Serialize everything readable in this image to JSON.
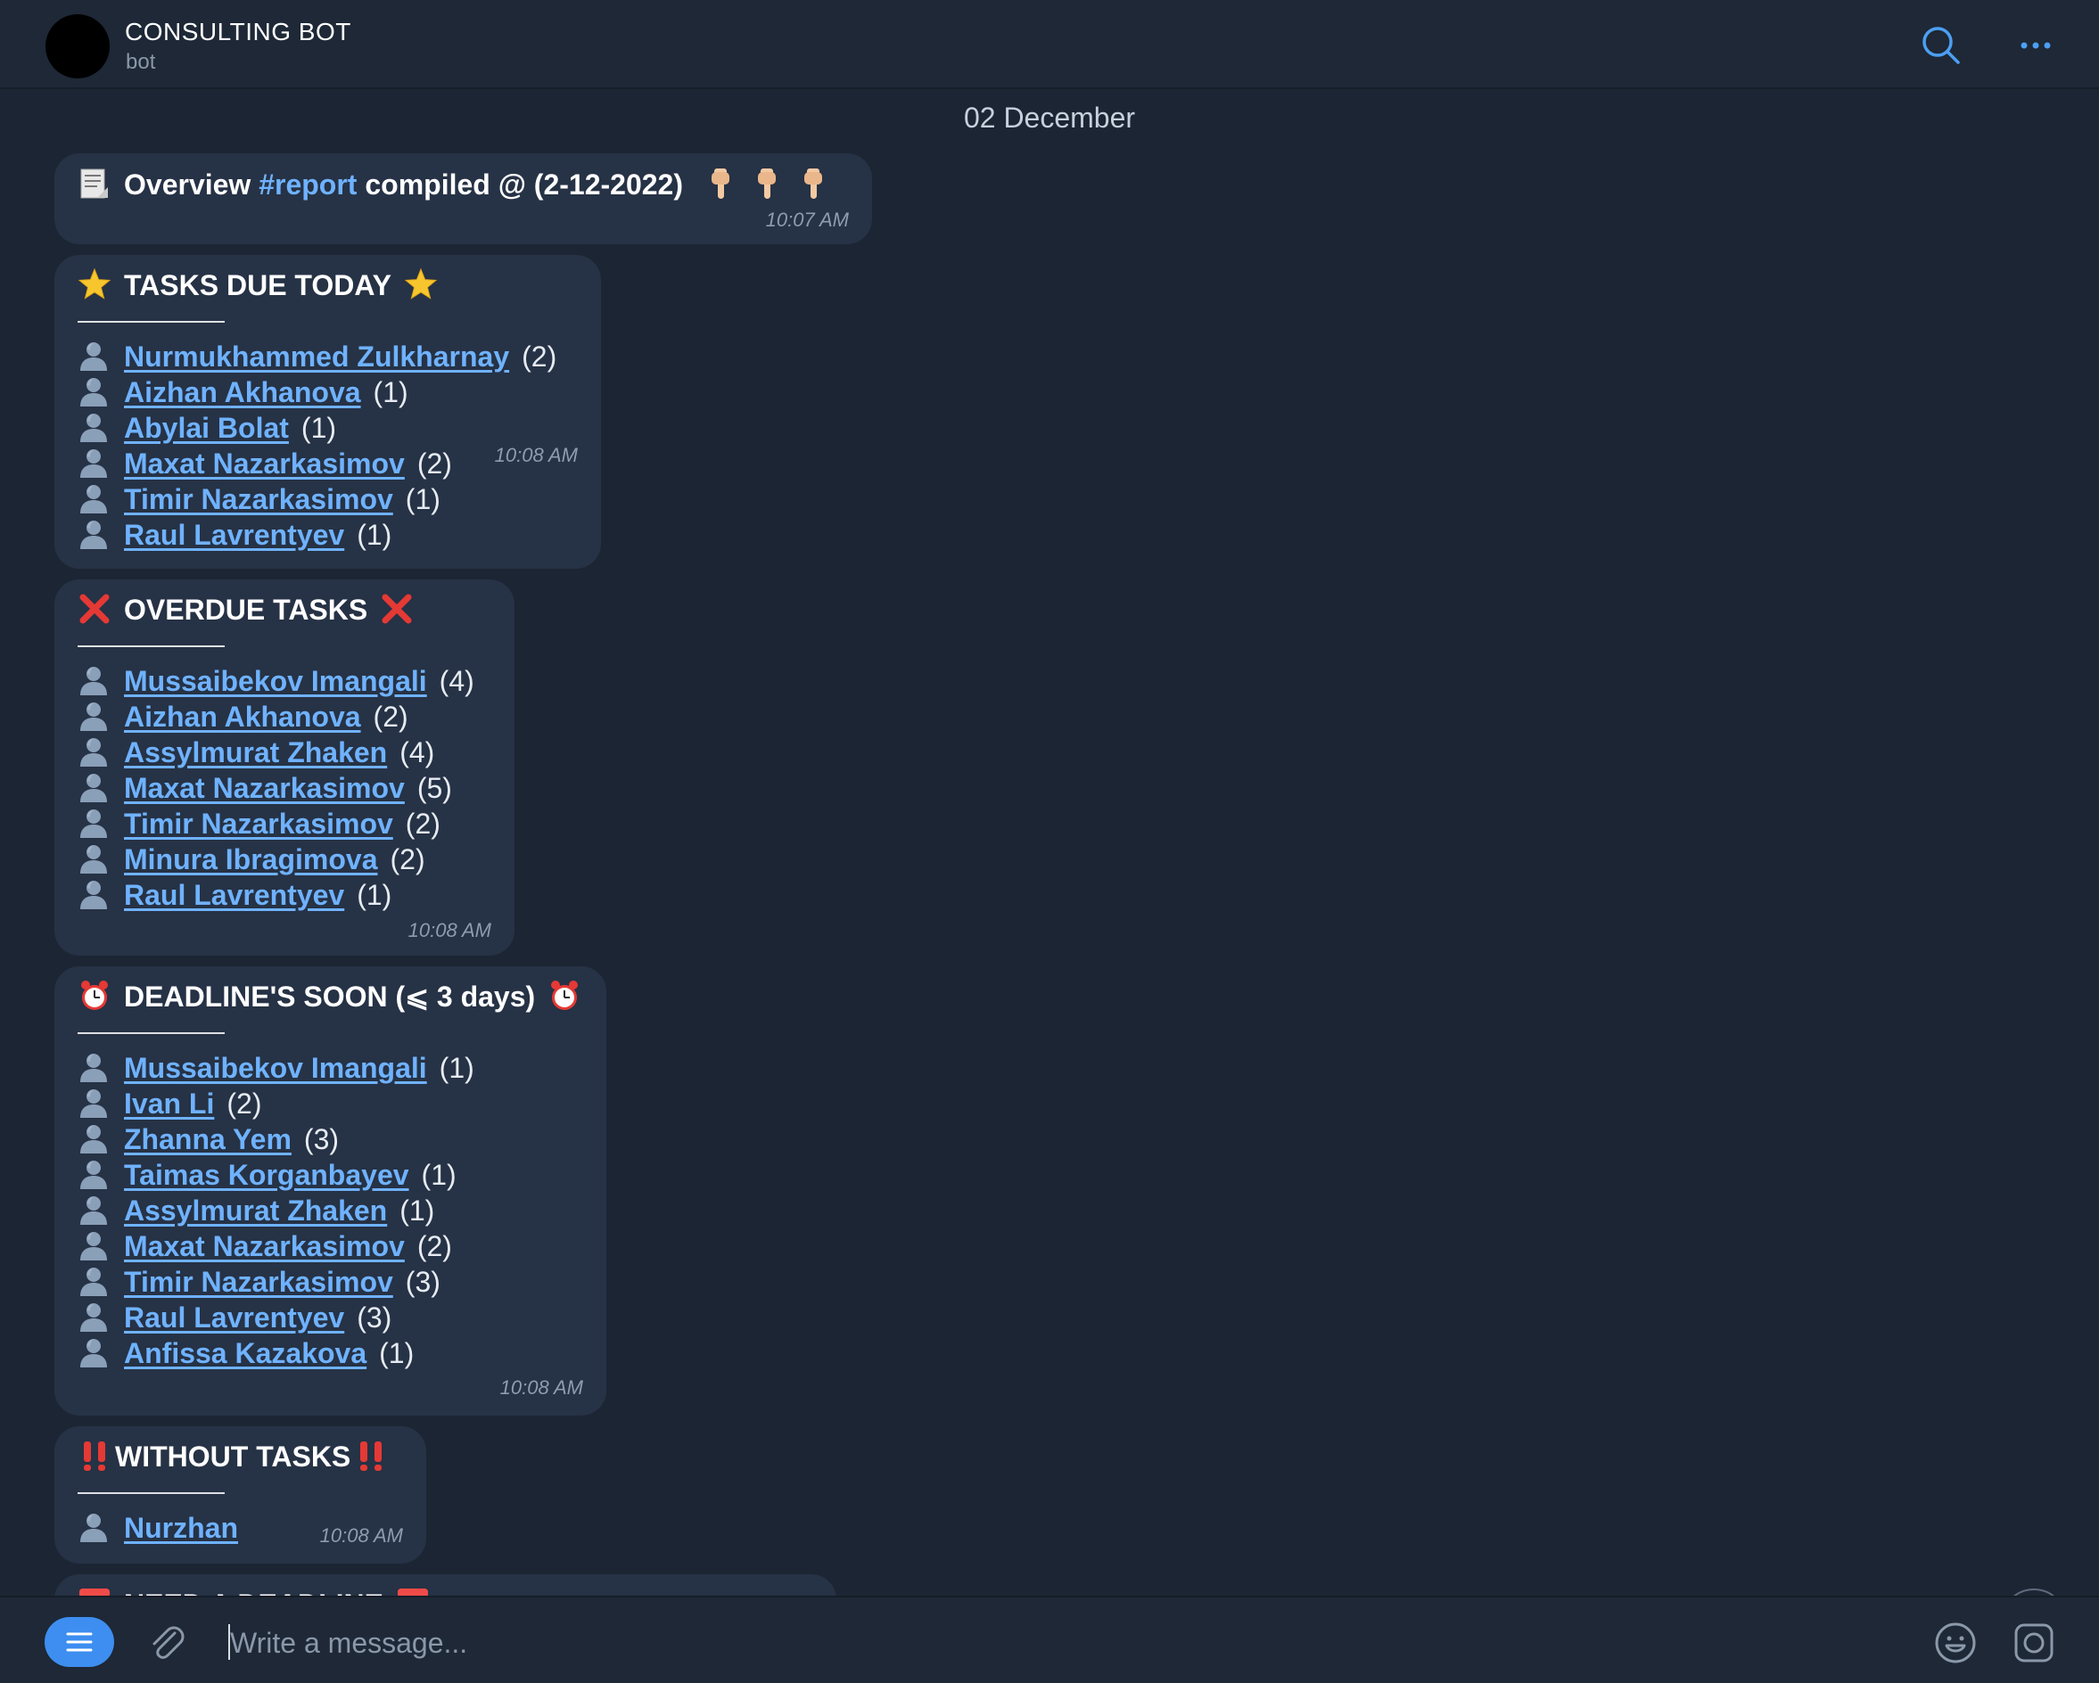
{
  "header": {
    "title": "CONSULTING BOT",
    "subtitle": "bot"
  },
  "chat": {
    "date_separator": "02 December",
    "overview": {
      "prefix": "Overview",
      "hashtag": "#report",
      "suffix": "compiled @ (2-12-2022)",
      "time": "10:07 AM"
    },
    "due_today": {
      "title": "TASKS DUE TODAY",
      "time": "10:08 AM",
      "rows": [
        {
          "name": "Nurmukhammed Zulkharnay",
          "count": "(2)"
        },
        {
          "name": "Aizhan Akhanova",
          "count": "(1)"
        },
        {
          "name": "Abylai Bolat",
          "count": "(1)"
        },
        {
          "name": "Maxat Nazarkasimov",
          "count": "(2)"
        },
        {
          "name": "Timir Nazarkasimov",
          "count": "(1)"
        },
        {
          "name": "Raul Lavrentyev",
          "count": "(1)"
        }
      ]
    },
    "overdue": {
      "title": "OVERDUE TASKS",
      "time": "10:08 AM",
      "rows": [
        {
          "name": "Mussaibekov Imangali",
          "count": "(4)"
        },
        {
          "name": "Aizhan Akhanova",
          "count": "(2)"
        },
        {
          "name": "Assylmurat Zhaken",
          "count": "(4)"
        },
        {
          "name": "Maxat Nazarkasimov",
          "count": "(5)"
        },
        {
          "name": "Timir Nazarkasimov",
          "count": "(2)"
        },
        {
          "name": "Minura Ibragimova",
          "count": "(2)"
        },
        {
          "name": "Raul Lavrentyev",
          "count": "(1)"
        }
      ]
    },
    "deadline_soon": {
      "title": "DEADLINE'S SOON (⩽ 3 days)",
      "time": "10:08 AM",
      "rows": [
        {
          "name": "Mussaibekov Imangali",
          "count": "(1)"
        },
        {
          "name": "Ivan Li",
          "count": "(2)"
        },
        {
          "name": "Zhanna Yem",
          "count": "(3)"
        },
        {
          "name": "Taimas Korganbayev",
          "count": "(1)"
        },
        {
          "name": "Assylmurat Zhaken",
          "count": "(1)"
        },
        {
          "name": "Maxat Nazarkasimov",
          "count": "(2)"
        },
        {
          "name": "Timir Nazarkasimov",
          "count": "(3)"
        },
        {
          "name": "Raul Lavrentyev",
          "count": "(3)"
        },
        {
          "name": "Anfissa Kazakova",
          "count": "(1)"
        }
      ]
    },
    "without_tasks": {
      "title": "WITHOUT TASKS",
      "time": "10:08 AM",
      "rows": [
        {
          "name": "Nurzhan",
          "count": ""
        }
      ]
    },
    "need_deadline": {
      "title": "NEED A DEADLINE"
    }
  },
  "composer": {
    "placeholder": "Write a message..."
  },
  "icons": {
    "header": [
      "search-icon",
      "more-icon"
    ],
    "composer": [
      "menu-icon",
      "attach-icon",
      "emoji-icon",
      "camera-icon"
    ],
    "messages": [
      "document-icon",
      "pointing-down-icon",
      "star-icon",
      "cross-mark-icon",
      "alarm-clock-icon",
      "double-exclamation-icon",
      "red-square-icon",
      "user-silhouette-icon",
      "chevron-down-icon"
    ]
  },
  "colors": {
    "background": "#1c2533",
    "bubble": "#263245",
    "link": "#6fb2ff",
    "accent": "#3d8ef0",
    "timestamp": "#8f9cae"
  }
}
